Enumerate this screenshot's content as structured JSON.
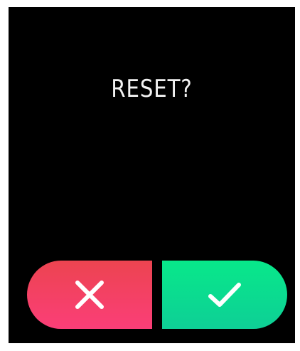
{
  "dialog": {
    "title": "RESET?",
    "cancel_icon": "close-icon",
    "confirm_icon": "checkmark-icon"
  },
  "colors": {
    "background": "#000000",
    "cancel_top": "#ec4450",
    "cancel_bottom": "#fb3e78",
    "confirm_top": "#08e88a",
    "confirm_bottom": "#0ecf96",
    "text": "#f2f2f2"
  }
}
